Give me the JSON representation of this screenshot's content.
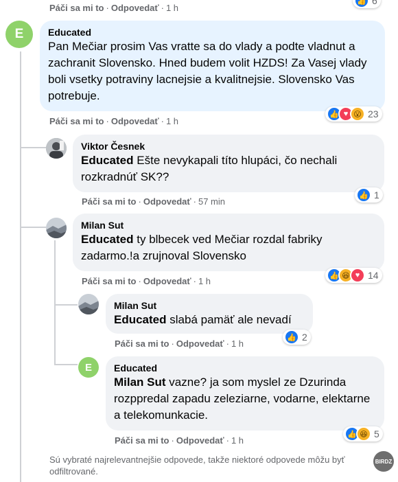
{
  "top": {
    "like": "Páči sa mi to",
    "reply": "Odpovedať",
    "time": "1 h",
    "reaction_count": "6"
  },
  "comments": [
    {
      "author": "Educated",
      "avatar_letter": "E",
      "text": "Pan Mečiar prosim Vas vratte sa do vlady a podte vladnut a zachranit Slovensko. Hned budem volit HZDS! Za Vasej vlady boli vsetky potraviny lacnejsie a kvalitnejsie. Slovensko Vas potrebuje.",
      "like": "Páči sa mi to",
      "reply": "Odpovedať",
      "time": "1 h",
      "reaction_count": "23",
      "reactions": [
        "like-icon",
        "love-icon",
        "wow-icon"
      ]
    },
    {
      "author": "Viktor Česnek",
      "mention": "Educated",
      "text": " Ešte nevykapali títo hlupáci, čo nechali rozkradnúť SK??",
      "like": "Páči sa mi to",
      "reply": "Odpovedať",
      "time": "57 min",
      "reaction_count": "1",
      "reactions": [
        "like-icon"
      ]
    },
    {
      "author": "Milan Sut",
      "mention": "Educated",
      "text": " ty blbecek ved Mečiar rozdal fabriky zadarmo.!a zrujnoval Slovensko",
      "like": "Páči sa mi to",
      "reply": "Odpovedať",
      "time": "1 h",
      "reaction_count": "14",
      "reactions": [
        "like-icon",
        "haha-icon",
        "love-icon"
      ]
    },
    {
      "author": "Milan Sut",
      "mention": "Educated",
      "text": " slabá pamäť ale nevadí",
      "like": "Páči sa mi to",
      "reply": "Odpovedať",
      "time": "1 h",
      "reaction_count": "2",
      "reactions": [
        "like-icon"
      ]
    },
    {
      "author": "Educated",
      "avatar_letter": "E",
      "mention": "Milan Sut",
      "text": " vazne? ja som myslel ze Dzurinda rozppredal zapadu zeleziarne, vodarne, elektarne a telekomunkacie.",
      "like": "Páči sa mi to",
      "reply": "Odpovedať",
      "time": "1 h",
      "reaction_count": "5",
      "reactions": [
        "like-icon",
        "haha-icon"
      ]
    }
  ],
  "footer_note": "Sú vybraté najrelevantnejšie odpovede, takže niektoré odpovede môžu byť odfiltrované.",
  "watermark": "BIRDZ",
  "colors": {
    "bubble": "#f0f2f5",
    "bubble_highlight": "#e7f3ff",
    "meta": "#65676b",
    "avatar_green": "#8fd26a",
    "like_blue": "#1877f2"
  }
}
